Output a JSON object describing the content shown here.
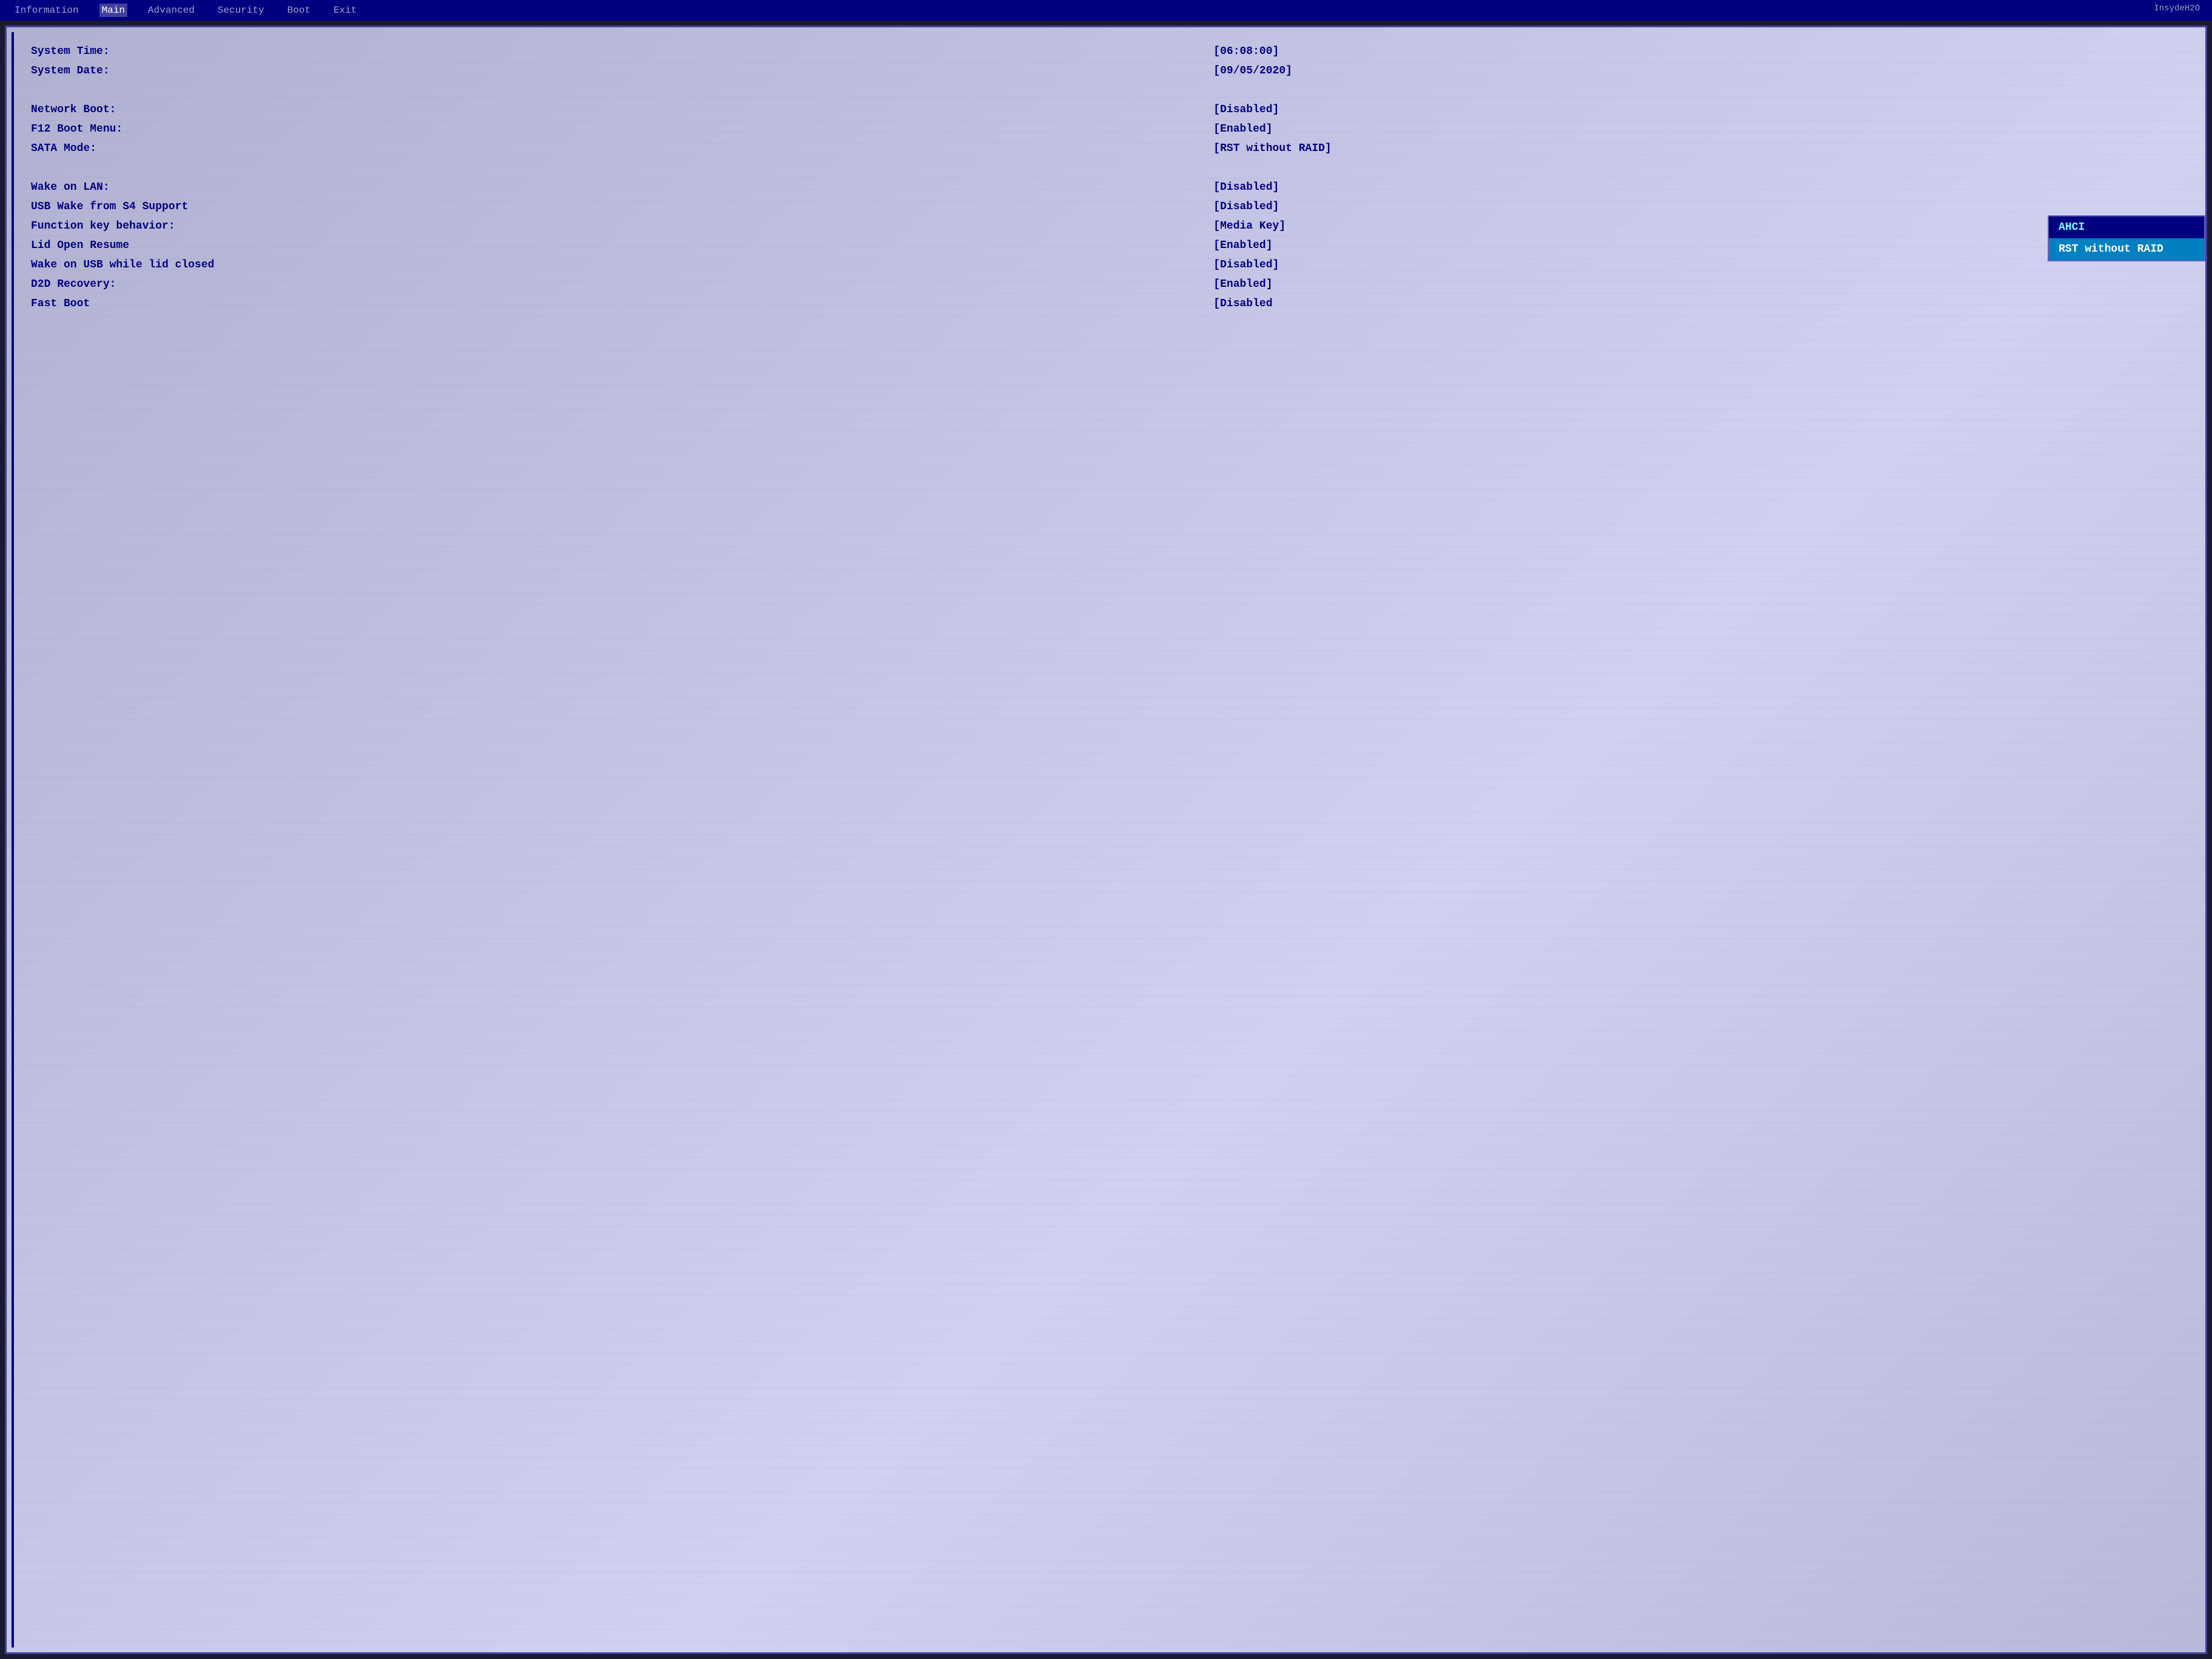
{
  "brand": "InsydeH2O",
  "nav": {
    "items": [
      {
        "label": "Information",
        "active": false
      },
      {
        "label": "Main",
        "active": true
      },
      {
        "label": "Advanced",
        "active": false
      },
      {
        "label": "Security",
        "active": false
      },
      {
        "label": "Boot",
        "active": false
      },
      {
        "label": "Exit",
        "active": false
      }
    ]
  },
  "settings": [
    {
      "label": "System Time:",
      "value": "[06:08:00]",
      "group": 1
    },
    {
      "label": "System Date:",
      "value": "[09/05/2020]",
      "group": 1
    },
    {
      "label": "",
      "value": "",
      "spacer": true
    },
    {
      "label": "Network Boot:",
      "value": "[Disabled]",
      "group": 2
    },
    {
      "label": "F12 Boot Menu:",
      "value": "[Enabled]",
      "group": 2
    },
    {
      "label": "SATA Mode:",
      "value": "[RST without RAID]",
      "group": 2
    },
    {
      "label": "",
      "value": "",
      "spacer": true
    },
    {
      "label": "Wake on LAN:",
      "value": "[Disabled]",
      "group": 3
    },
    {
      "label": "USB Wake from S4 Support",
      "value": "[Disabled]",
      "group": 3
    },
    {
      "label": "Function key behavior:",
      "value": "[Media Key]",
      "group": 3
    },
    {
      "label": "Lid Open Resume",
      "value": "[Enabled]",
      "group": 3
    },
    {
      "label": "Wake on USB while lid closed",
      "value": "[Disabled]",
      "group": 3
    },
    {
      "label": "D2D Recovery:",
      "value": "[Enabled]",
      "group": 3
    },
    {
      "label": "Fast Boot",
      "value": "[Disabled",
      "group": 3
    }
  ],
  "dropdown": {
    "options": [
      {
        "label": "AHCI",
        "selected": false
      },
      {
        "label": "RST without RAID",
        "selected": true
      }
    ]
  }
}
